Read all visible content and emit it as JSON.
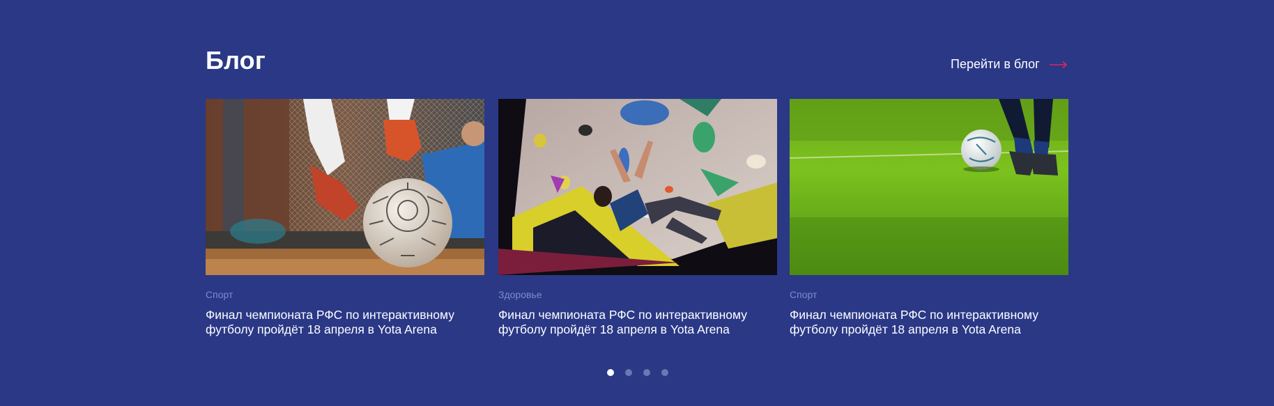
{
  "header": {
    "title": "Блог",
    "link_label": "Перейти в блог",
    "link_icon": "arrow-right-icon",
    "accent_color": "#e0245e"
  },
  "cards": [
    {
      "category": "Спорт",
      "title": "Финал чемпионата РФС по интерактивному футболу пройдёт 18 апреля в Yota Arena",
      "image": "football-tackle-photo"
    },
    {
      "category": "Здоровье",
      "title": "Финал чемпионата РФС по интерактивному футболу пройдёт 18 апреля в Yota Arena",
      "image": "climbing-wall-photo"
    },
    {
      "category": "Спорт",
      "title": "Финал чемпионата РФС по интерактивному футболу пройдёт 18 апреля в Yota Arena",
      "image": "football-grass-photo"
    }
  ],
  "pagination": {
    "total": 4,
    "active": 1
  },
  "colors": {
    "background": "#2a3886",
    "category": "#7b8cd0",
    "dot_inactive": "#6a78b3",
    "dot_active": "#ffffff"
  }
}
